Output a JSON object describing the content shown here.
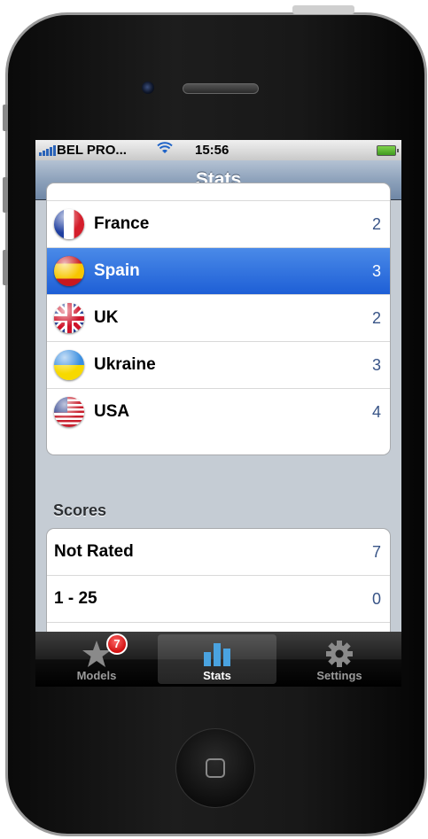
{
  "status_bar": {
    "carrier": "BEL PRO...",
    "time": "15:56"
  },
  "nav_bar": {
    "title": "Stats"
  },
  "countries": [
    {
      "name": "France",
      "count": "2",
      "flag_icon": "france-flag-icon",
      "selected": false
    },
    {
      "name": "Spain",
      "count": "3",
      "flag_icon": "spain-flag-icon",
      "selected": true
    },
    {
      "name": "UK",
      "count": "2",
      "flag_icon": "uk-flag-icon",
      "selected": false
    },
    {
      "name": "Ukraine",
      "count": "3",
      "flag_icon": "ukraine-flag-icon",
      "selected": false
    },
    {
      "name": "USA",
      "count": "4",
      "flag_icon": "usa-flag-icon",
      "selected": false
    }
  ],
  "scores": {
    "header": "Scores",
    "rows": [
      {
        "name": "Not Rated",
        "count": "7"
      },
      {
        "name": "1 - 25",
        "count": "0"
      }
    ]
  },
  "tab_bar": {
    "items": [
      {
        "label": "Models",
        "icon": "star-icon",
        "badge": "7",
        "active": false
      },
      {
        "label": "Stats",
        "icon": "bar-chart-icon",
        "active": true
      },
      {
        "label": "Settings",
        "icon": "gear-icon",
        "active": false
      }
    ]
  },
  "colors": {
    "selection": "#1e5fd6",
    "nav_bar": "#8ea2bb",
    "value_text": "#385487",
    "table_background": "#c5ccd4"
  }
}
